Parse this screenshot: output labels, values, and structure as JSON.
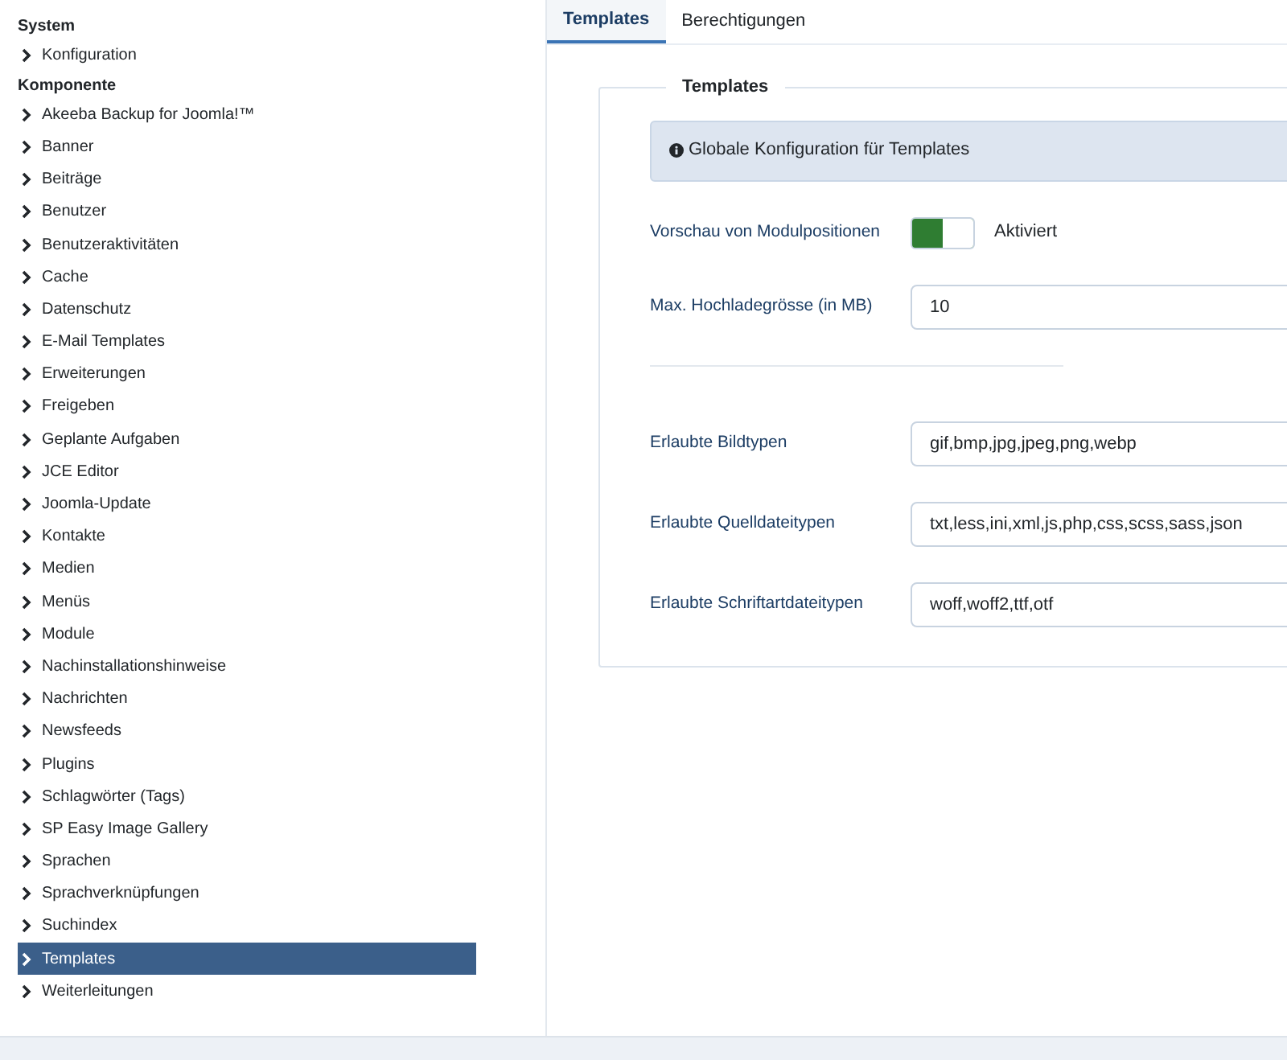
{
  "sidebar": {
    "sections": [
      {
        "title": "System",
        "items": [
          {
            "label": "Konfiguration",
            "selected": false
          }
        ]
      },
      {
        "title": "Komponente",
        "items": [
          {
            "label": "Akeeba Backup for Joomla!™",
            "selected": false
          },
          {
            "label": "Banner",
            "selected": false
          },
          {
            "label": "Beiträge",
            "selected": false
          },
          {
            "label": "Benutzer",
            "selected": false
          },
          {
            "label": "Benutzeraktivitäten",
            "selected": false
          },
          {
            "label": "Cache",
            "selected": false
          },
          {
            "label": "Datenschutz",
            "selected": false
          },
          {
            "label": "E-Mail Templates",
            "selected": false
          },
          {
            "label": "Erweiterungen",
            "selected": false
          },
          {
            "label": "Freigeben",
            "selected": false
          },
          {
            "label": "Geplante Aufgaben",
            "selected": false
          },
          {
            "label": "JCE Editor",
            "selected": false
          },
          {
            "label": "Joomla-Update",
            "selected": false
          },
          {
            "label": "Kontakte",
            "selected": false
          },
          {
            "label": "Medien",
            "selected": false
          },
          {
            "label": "Menüs",
            "selected": false
          },
          {
            "label": "Module",
            "selected": false
          },
          {
            "label": "Nachinstallationshinweise",
            "selected": false
          },
          {
            "label": "Nachrichten",
            "selected": false
          },
          {
            "label": "Newsfeeds",
            "selected": false
          },
          {
            "label": "Plugins",
            "selected": false
          },
          {
            "label": "Schlagwörter (Tags)",
            "selected": false
          },
          {
            "label": "SP Easy Image Gallery",
            "selected": false
          },
          {
            "label": "Sprachen",
            "selected": false
          },
          {
            "label": "Sprachverknüpfungen",
            "selected": false
          },
          {
            "label": "Suchindex",
            "selected": false
          },
          {
            "label": "Templates",
            "selected": true
          },
          {
            "label": "Weiterleitungen",
            "selected": false
          }
        ]
      }
    ]
  },
  "tabs": [
    {
      "label": "Templates",
      "selected": true
    },
    {
      "label": "Berechtigungen",
      "selected": false
    }
  ],
  "fieldset": {
    "legend": "Templates",
    "info": "Globale Konfiguration für Templates",
    "groups": [
      [
        {
          "kind": "switch",
          "label": "Vorschau von Modulpositionen",
          "on": true,
          "state_label": "Aktiviert"
        },
        {
          "kind": "text",
          "label": "Max. Hochladegrösse (in MB)",
          "value": "10"
        }
      ],
      [
        {
          "kind": "text",
          "label": "Erlaubte Bildtypen",
          "value": "gif,bmp,jpg,jpeg,png,webp"
        },
        {
          "kind": "text",
          "label": "Erlaubte Quelldateitypen",
          "value": "txt,less,ini,xml,js,php,css,scss,sass,json"
        },
        {
          "kind": "text",
          "label": "Erlaubte Schriftartdateitypen",
          "value": "woff,woff2,ttf,otf"
        }
      ]
    ]
  }
}
